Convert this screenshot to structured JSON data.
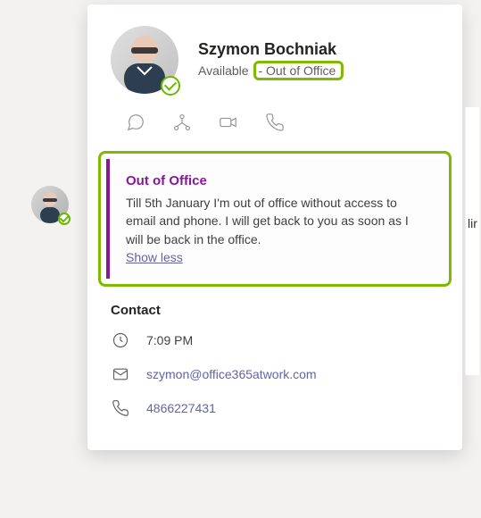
{
  "profile": {
    "name": "Szymon Bochniak",
    "presence": "Available",
    "ooo_tag": "- Out of Office"
  },
  "ooo": {
    "title": "Out of Office",
    "message": "Till 5th January I'm out of office without access to email and phone. I will get back to you as soon as I will be back in the office.",
    "toggle": "Show less"
  },
  "contact": {
    "heading": "Contact",
    "time": "7:09 PM",
    "email": "szymon@office365atwork.com",
    "phone": "4866227431"
  },
  "side_hint": "lir"
}
